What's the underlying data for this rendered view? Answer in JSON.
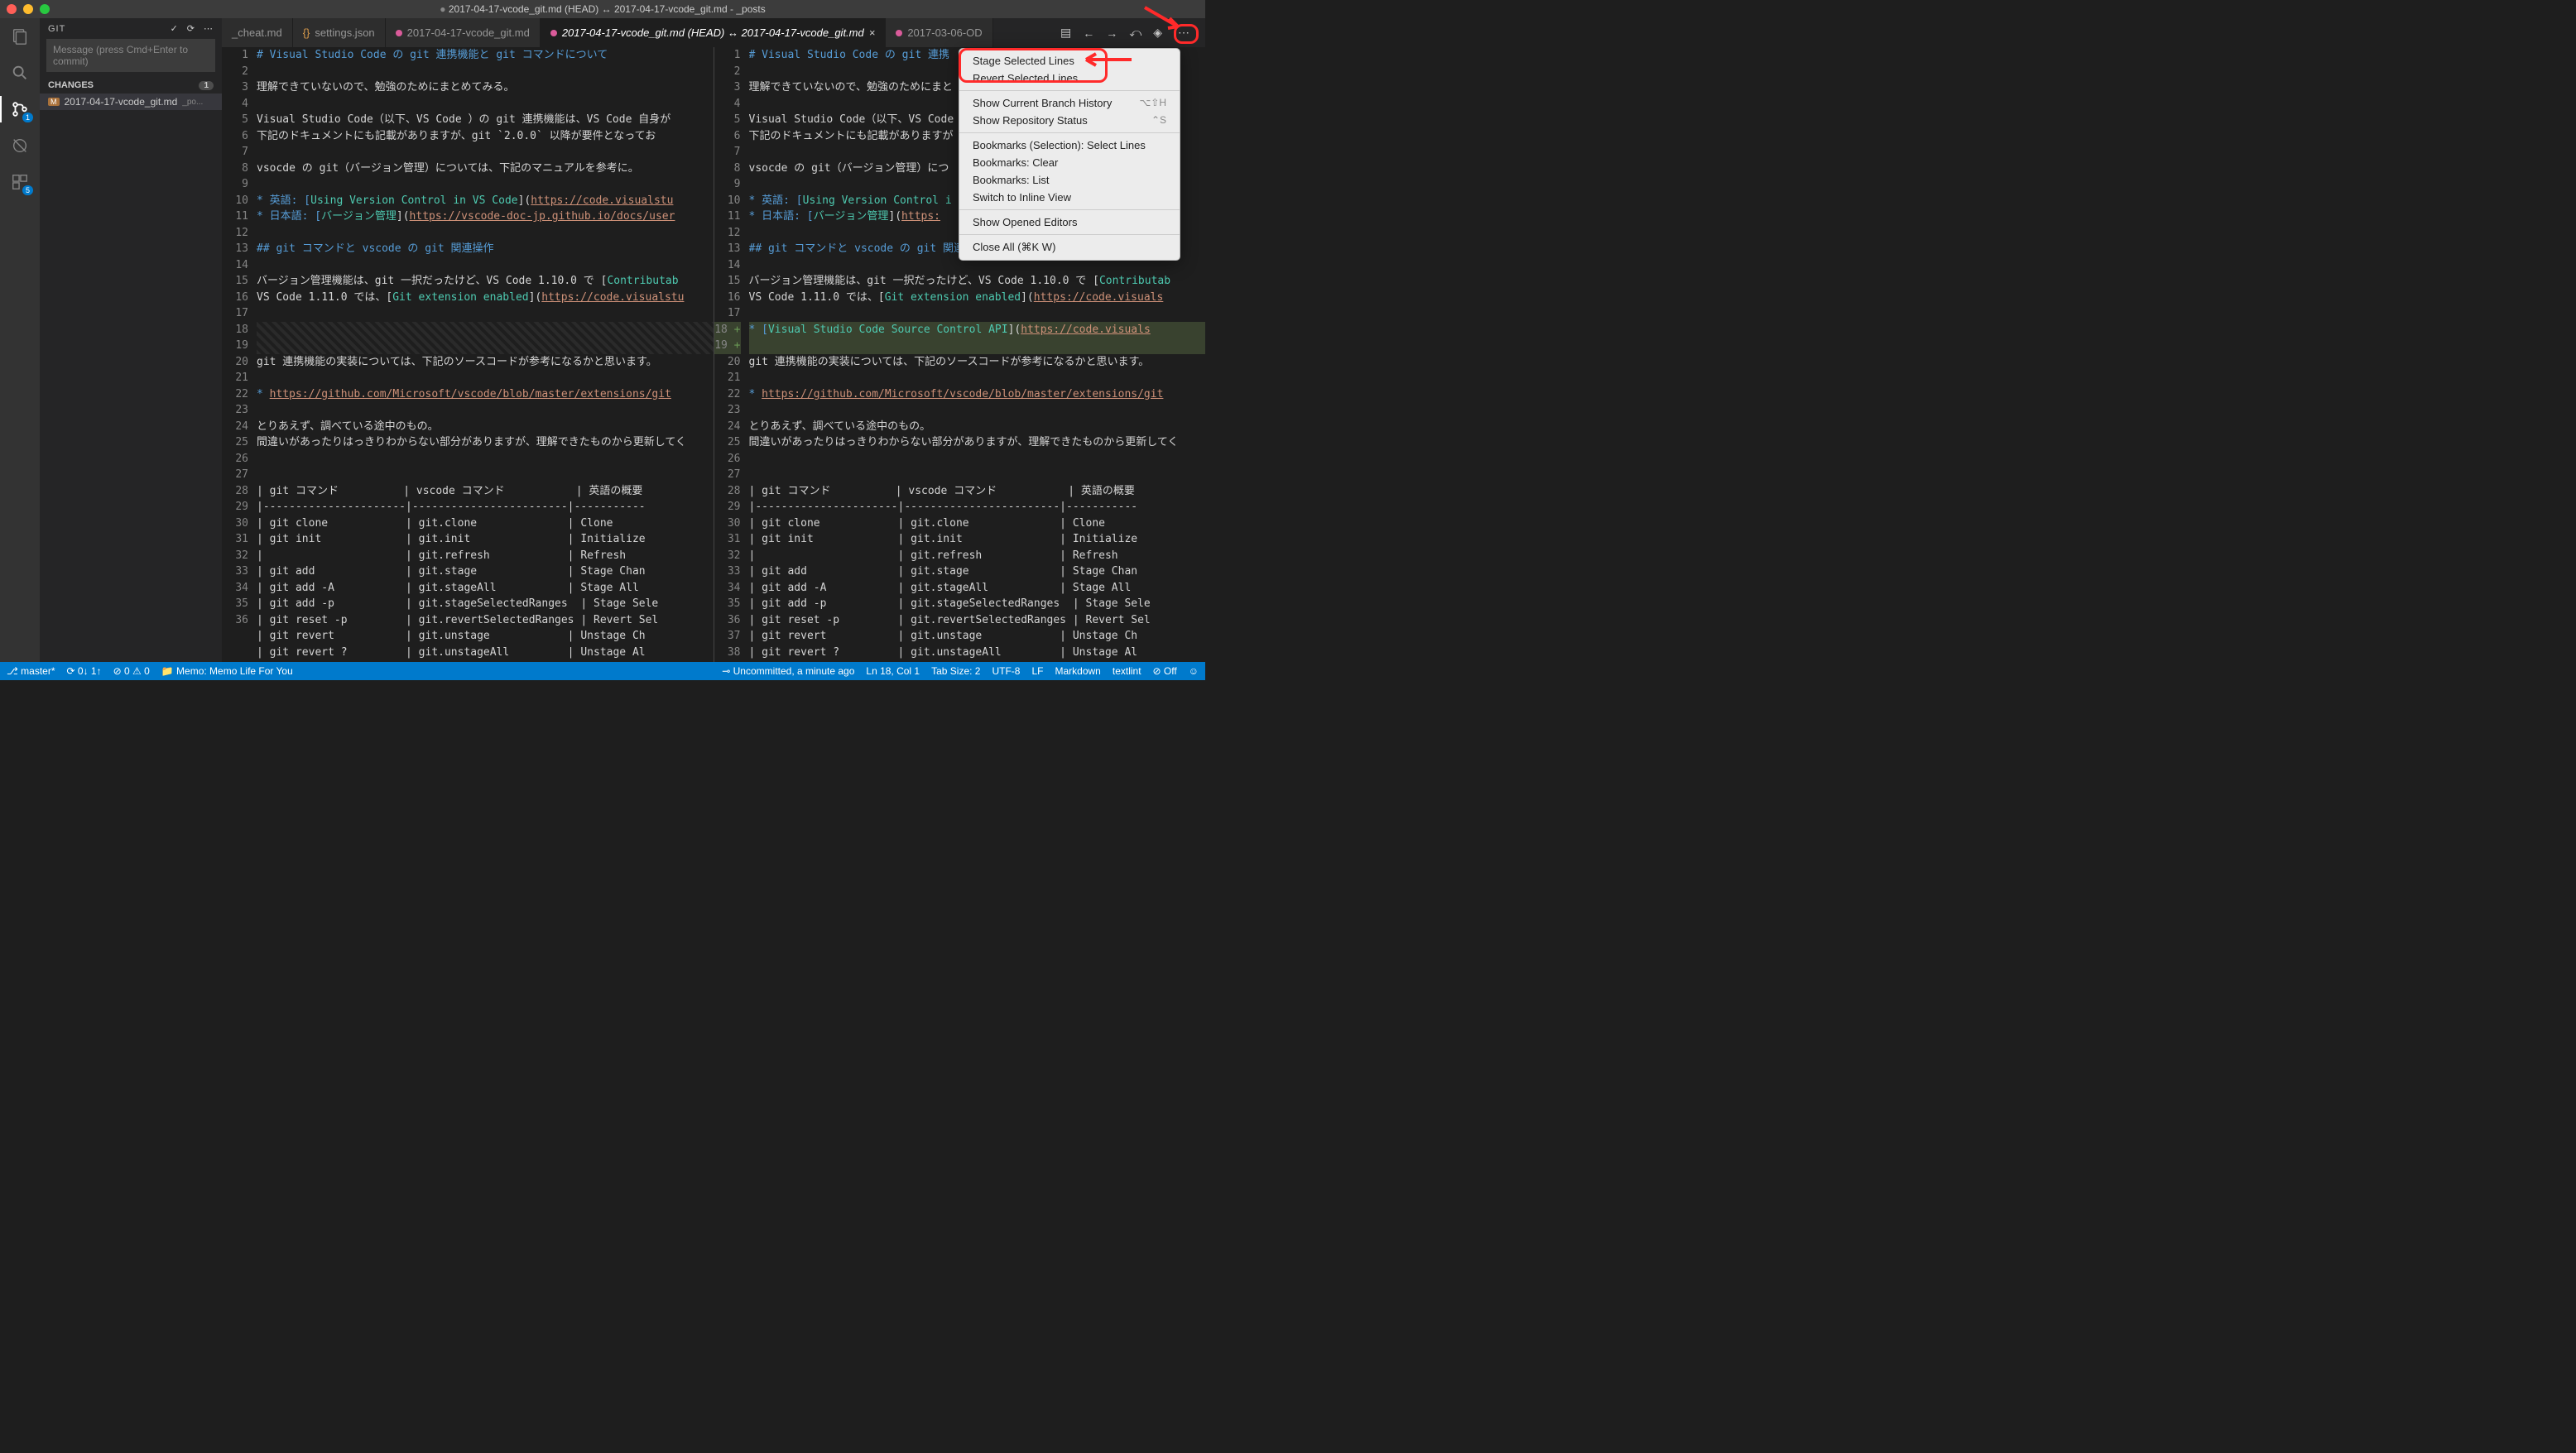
{
  "window_title": "2017-04-17-vcode_git.md (HEAD) ↔ 2017-04-17-vcode_git.md - _posts",
  "sidebar": {
    "head": "GIT",
    "commit_placeholder": "Message (press Cmd+Enter to commit)",
    "changes_label": "CHANGES",
    "changes_count": "1",
    "file_name": "2017-04-17-vcode_git.md",
    "file_path": "_po..."
  },
  "activity": {
    "scm_badge": "1",
    "ext_badge": "5"
  },
  "tabs": {
    "t0": "_cheat.md",
    "t1": "settings.json",
    "t2": "2017-04-17-vcode_git.md",
    "t3": "2017-04-17-vcode_git.md (HEAD) ↔ 2017-04-17-vcode_git.md",
    "t4": "2017-03-06-OD"
  },
  "menu": {
    "stage": "Stage Selected Lines",
    "revert": "Revert Selected Lines",
    "branchHist": "Show Current Branch History",
    "branchHist_sc": "⌥⇧H",
    "repoStat": "Show Repository Status",
    "repoStat_sc": "⌃S",
    "bmSel": "Bookmarks (Selection): Select Lines",
    "bmClear": "Bookmarks: Clear",
    "bmList": "Bookmarks: List",
    "inline": "Switch to Inline View",
    "opened": "Show Opened Editors",
    "closeAll": "Close All (⌘K W)"
  },
  "status": {
    "branch": "master*",
    "sync": "⟳ 0↓ 1↑",
    "errs": "⊘ 0 ⚠ 0",
    "memo": "Memo: Memo Life For You",
    "uncommitted": "Uncommitted, a minute ago",
    "pos": "Ln 18, Col 1",
    "tab": "Tab Size: 2",
    "enc": "UTF-8",
    "eol": "LF",
    "lang": "Markdown",
    "lint": "textlint",
    "off": "⊘ Off"
  },
  "code": {
    "l1": "# Visual Studio Code の git 連携機能と git コマンドについて",
    "l3": "理解できていないので、勉強のためにまとめてみる。",
    "l5": "Visual Studio Code（以下、VS Code ）の git 連携機能は、VS Code 自身が",
    "l6": "下記のドキュメントにも記載がありますが、git `2.0.0` 以降が要件となってお",
    "l8": "vsocde の git（バージョン管理）については、下記のマニュアルを参考に。",
    "l10_a": "* 英語: [",
    "l10_b": "Using Version Control in VS Code",
    "l10_c": "](",
    "l10_d": "https://code.visualstu",
    "l11_a": "* 日本語: [",
    "l11_b": "バージョン管理",
    "l11_c": "](",
    "l11_d": "https://vscode-doc-jp.github.io/docs/user",
    "l13": "## git コマンドと vscode の git 関連操作",
    "l15_a": "バージョン管理機能は、git 一択だったけど、VS Code 1.10.0 で [",
    "l15_b": "Contributab",
    "l16_a": "VS Code 1.11.0 では、[",
    "l16_b": "Git extension enabled",
    "l16_c": "](",
    "l16_d": "https://code.visualstu",
    "r18_a": "* [",
    "r18_b": "Visual Studio Code Source Control API",
    "r18_c": "](",
    "r18_d": "https://code.visuals",
    "l18": "git 連携機能の実装については、下記のソースコードが参考になるかと思います。",
    "l20_a": "* ",
    "l20_b": "https://github.com/Microsoft/vscode/blob/master/extensions/git",
    "l22": "とりあえず、調べている途中のもの。",
    "l23": "間違いがあったりはっきりわからない部分がありますが、理解できたものから更新してく",
    "l26": "| git コマンド          | vscode コマンド           | 英語の概要",
    "l27": "|----------------------|------------------------|-----------",
    "l28": "| git clone            | git.clone              | Clone",
    "l29": "| git init             | git.init               | Initialize",
    "l30": "|                      | git.refresh            | Refresh",
    "l31": "| git add              | git.stage              | Stage Chan",
    "l32": "| git add -A           | git.stageAll           | Stage All",
    "l33": "| git add -p           | git.stageSelectedRanges  | Stage Sele",
    "l34": "| git reset -p         | git.revertSelectedRanges | Revert Sel",
    "l35": "| git revert           | git.unstage            | Unstage Ch",
    "l36": "| git revert ?         | git.unstageAll         | Unstage Al",
    "r5": "Visual Studio Code（以下、VS Code ）の",
    "r6": "下記のドキュメントにも記載がありますが",
    "r8": "vsocde の git（バージョン管理）につ",
    "r10_d": "https://code.visuals",
    "r13": "## git コマンドと vscode の git 関連操作",
    "r1": "# Visual Studio Code の git 連携",
    "r3": "理解できていないので、勉強のためにまと"
  },
  "gutters": {
    "left": [
      "1",
      "2",
      "3",
      "4",
      "5",
      "6",
      "7",
      "8",
      "9",
      "10",
      "11",
      "12",
      "13",
      "14",
      "15",
      "16",
      "17",
      "",
      "",
      "18",
      "19",
      "20",
      "21",
      "22",
      "23",
      "24",
      "25",
      "26",
      "27",
      "28",
      "29",
      "30",
      "31",
      "32",
      "33",
      "34",
      "35",
      "36"
    ],
    "right": [
      "1",
      "2",
      "3",
      "4",
      "5",
      "6",
      "7",
      "8",
      "9",
      "10",
      "11",
      "12",
      "13",
      "14",
      "15",
      "16",
      "17",
      "18",
      "19",
      "20",
      "21",
      "22",
      "23",
      "24",
      "25",
      "26",
      "27",
      "28",
      "29",
      "30",
      "31",
      "32",
      "33",
      "34",
      "35",
      "36",
      "37",
      "38"
    ]
  }
}
